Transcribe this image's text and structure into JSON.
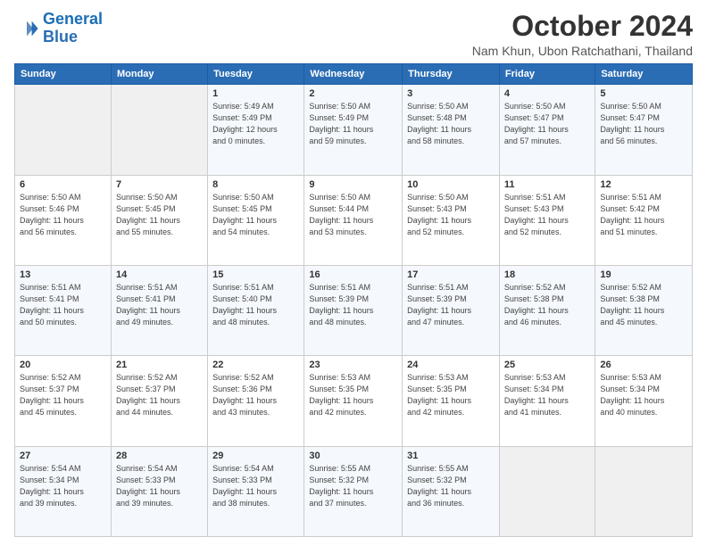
{
  "header": {
    "logo_general": "General",
    "logo_blue": "Blue",
    "month_title": "October 2024",
    "location": "Nam Khun, Ubon Ratchathani, Thailand"
  },
  "columns": [
    "Sunday",
    "Monday",
    "Tuesday",
    "Wednesday",
    "Thursday",
    "Friday",
    "Saturday"
  ],
  "weeks": [
    [
      {
        "day": "",
        "info": ""
      },
      {
        "day": "",
        "info": ""
      },
      {
        "day": "1",
        "info": "Sunrise: 5:49 AM\nSunset: 5:49 PM\nDaylight: 12 hours\nand 0 minutes."
      },
      {
        "day": "2",
        "info": "Sunrise: 5:50 AM\nSunset: 5:49 PM\nDaylight: 11 hours\nand 59 minutes."
      },
      {
        "day": "3",
        "info": "Sunrise: 5:50 AM\nSunset: 5:48 PM\nDaylight: 11 hours\nand 58 minutes."
      },
      {
        "day": "4",
        "info": "Sunrise: 5:50 AM\nSunset: 5:47 PM\nDaylight: 11 hours\nand 57 minutes."
      },
      {
        "day": "5",
        "info": "Sunrise: 5:50 AM\nSunset: 5:47 PM\nDaylight: 11 hours\nand 56 minutes."
      }
    ],
    [
      {
        "day": "6",
        "info": "Sunrise: 5:50 AM\nSunset: 5:46 PM\nDaylight: 11 hours\nand 56 minutes."
      },
      {
        "day": "7",
        "info": "Sunrise: 5:50 AM\nSunset: 5:45 PM\nDaylight: 11 hours\nand 55 minutes."
      },
      {
        "day": "8",
        "info": "Sunrise: 5:50 AM\nSunset: 5:45 PM\nDaylight: 11 hours\nand 54 minutes."
      },
      {
        "day": "9",
        "info": "Sunrise: 5:50 AM\nSunset: 5:44 PM\nDaylight: 11 hours\nand 53 minutes."
      },
      {
        "day": "10",
        "info": "Sunrise: 5:50 AM\nSunset: 5:43 PM\nDaylight: 11 hours\nand 52 minutes."
      },
      {
        "day": "11",
        "info": "Sunrise: 5:51 AM\nSunset: 5:43 PM\nDaylight: 11 hours\nand 52 minutes."
      },
      {
        "day": "12",
        "info": "Sunrise: 5:51 AM\nSunset: 5:42 PM\nDaylight: 11 hours\nand 51 minutes."
      }
    ],
    [
      {
        "day": "13",
        "info": "Sunrise: 5:51 AM\nSunset: 5:41 PM\nDaylight: 11 hours\nand 50 minutes."
      },
      {
        "day": "14",
        "info": "Sunrise: 5:51 AM\nSunset: 5:41 PM\nDaylight: 11 hours\nand 49 minutes."
      },
      {
        "day": "15",
        "info": "Sunrise: 5:51 AM\nSunset: 5:40 PM\nDaylight: 11 hours\nand 48 minutes."
      },
      {
        "day": "16",
        "info": "Sunrise: 5:51 AM\nSunset: 5:39 PM\nDaylight: 11 hours\nand 48 minutes."
      },
      {
        "day": "17",
        "info": "Sunrise: 5:51 AM\nSunset: 5:39 PM\nDaylight: 11 hours\nand 47 minutes."
      },
      {
        "day": "18",
        "info": "Sunrise: 5:52 AM\nSunset: 5:38 PM\nDaylight: 11 hours\nand 46 minutes."
      },
      {
        "day": "19",
        "info": "Sunrise: 5:52 AM\nSunset: 5:38 PM\nDaylight: 11 hours\nand 45 minutes."
      }
    ],
    [
      {
        "day": "20",
        "info": "Sunrise: 5:52 AM\nSunset: 5:37 PM\nDaylight: 11 hours\nand 45 minutes."
      },
      {
        "day": "21",
        "info": "Sunrise: 5:52 AM\nSunset: 5:37 PM\nDaylight: 11 hours\nand 44 minutes."
      },
      {
        "day": "22",
        "info": "Sunrise: 5:52 AM\nSunset: 5:36 PM\nDaylight: 11 hours\nand 43 minutes."
      },
      {
        "day": "23",
        "info": "Sunrise: 5:53 AM\nSunset: 5:35 PM\nDaylight: 11 hours\nand 42 minutes."
      },
      {
        "day": "24",
        "info": "Sunrise: 5:53 AM\nSunset: 5:35 PM\nDaylight: 11 hours\nand 42 minutes."
      },
      {
        "day": "25",
        "info": "Sunrise: 5:53 AM\nSunset: 5:34 PM\nDaylight: 11 hours\nand 41 minutes."
      },
      {
        "day": "26",
        "info": "Sunrise: 5:53 AM\nSunset: 5:34 PM\nDaylight: 11 hours\nand 40 minutes."
      }
    ],
    [
      {
        "day": "27",
        "info": "Sunrise: 5:54 AM\nSunset: 5:34 PM\nDaylight: 11 hours\nand 39 minutes."
      },
      {
        "day": "28",
        "info": "Sunrise: 5:54 AM\nSunset: 5:33 PM\nDaylight: 11 hours\nand 39 minutes."
      },
      {
        "day": "29",
        "info": "Sunrise: 5:54 AM\nSunset: 5:33 PM\nDaylight: 11 hours\nand 38 minutes."
      },
      {
        "day": "30",
        "info": "Sunrise: 5:55 AM\nSunset: 5:32 PM\nDaylight: 11 hours\nand 37 minutes."
      },
      {
        "day": "31",
        "info": "Sunrise: 5:55 AM\nSunset: 5:32 PM\nDaylight: 11 hours\nand 36 minutes."
      },
      {
        "day": "",
        "info": ""
      },
      {
        "day": "",
        "info": ""
      }
    ]
  ]
}
